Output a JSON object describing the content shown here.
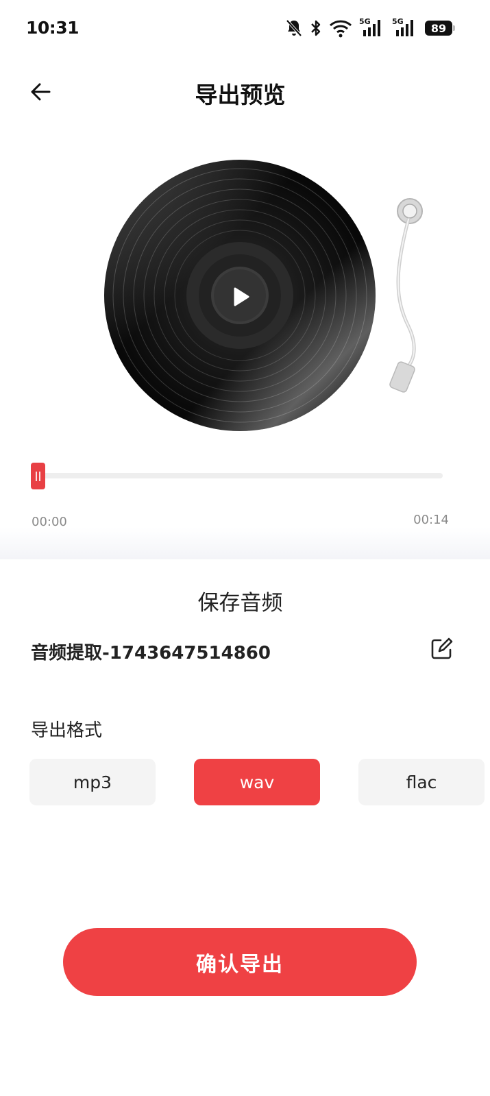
{
  "status_bar": {
    "time": "10:31",
    "network_label_1": "5G",
    "network_label_2": "5G",
    "battery": "89"
  },
  "header": {
    "title": "导出预览"
  },
  "player": {
    "current_time": "00:00",
    "total_time": "00:14",
    "progress": 0
  },
  "save": {
    "title": "保存音频",
    "file_name": "音频提取-1743647514860",
    "format_label": "导出格式",
    "formats": [
      "mp3",
      "wav",
      "flac"
    ],
    "selected_format": "wav",
    "confirm_label": "确认导出"
  },
  "colors": {
    "accent": "#ef4144",
    "chip_bg": "#f4f4f4",
    "track": "#eeeeee"
  },
  "icons": [
    "bell-off-icon",
    "bluetooth-icon",
    "wifi-icon",
    "signal-icon",
    "back-arrow-icon",
    "play-icon",
    "edit-icon"
  ]
}
